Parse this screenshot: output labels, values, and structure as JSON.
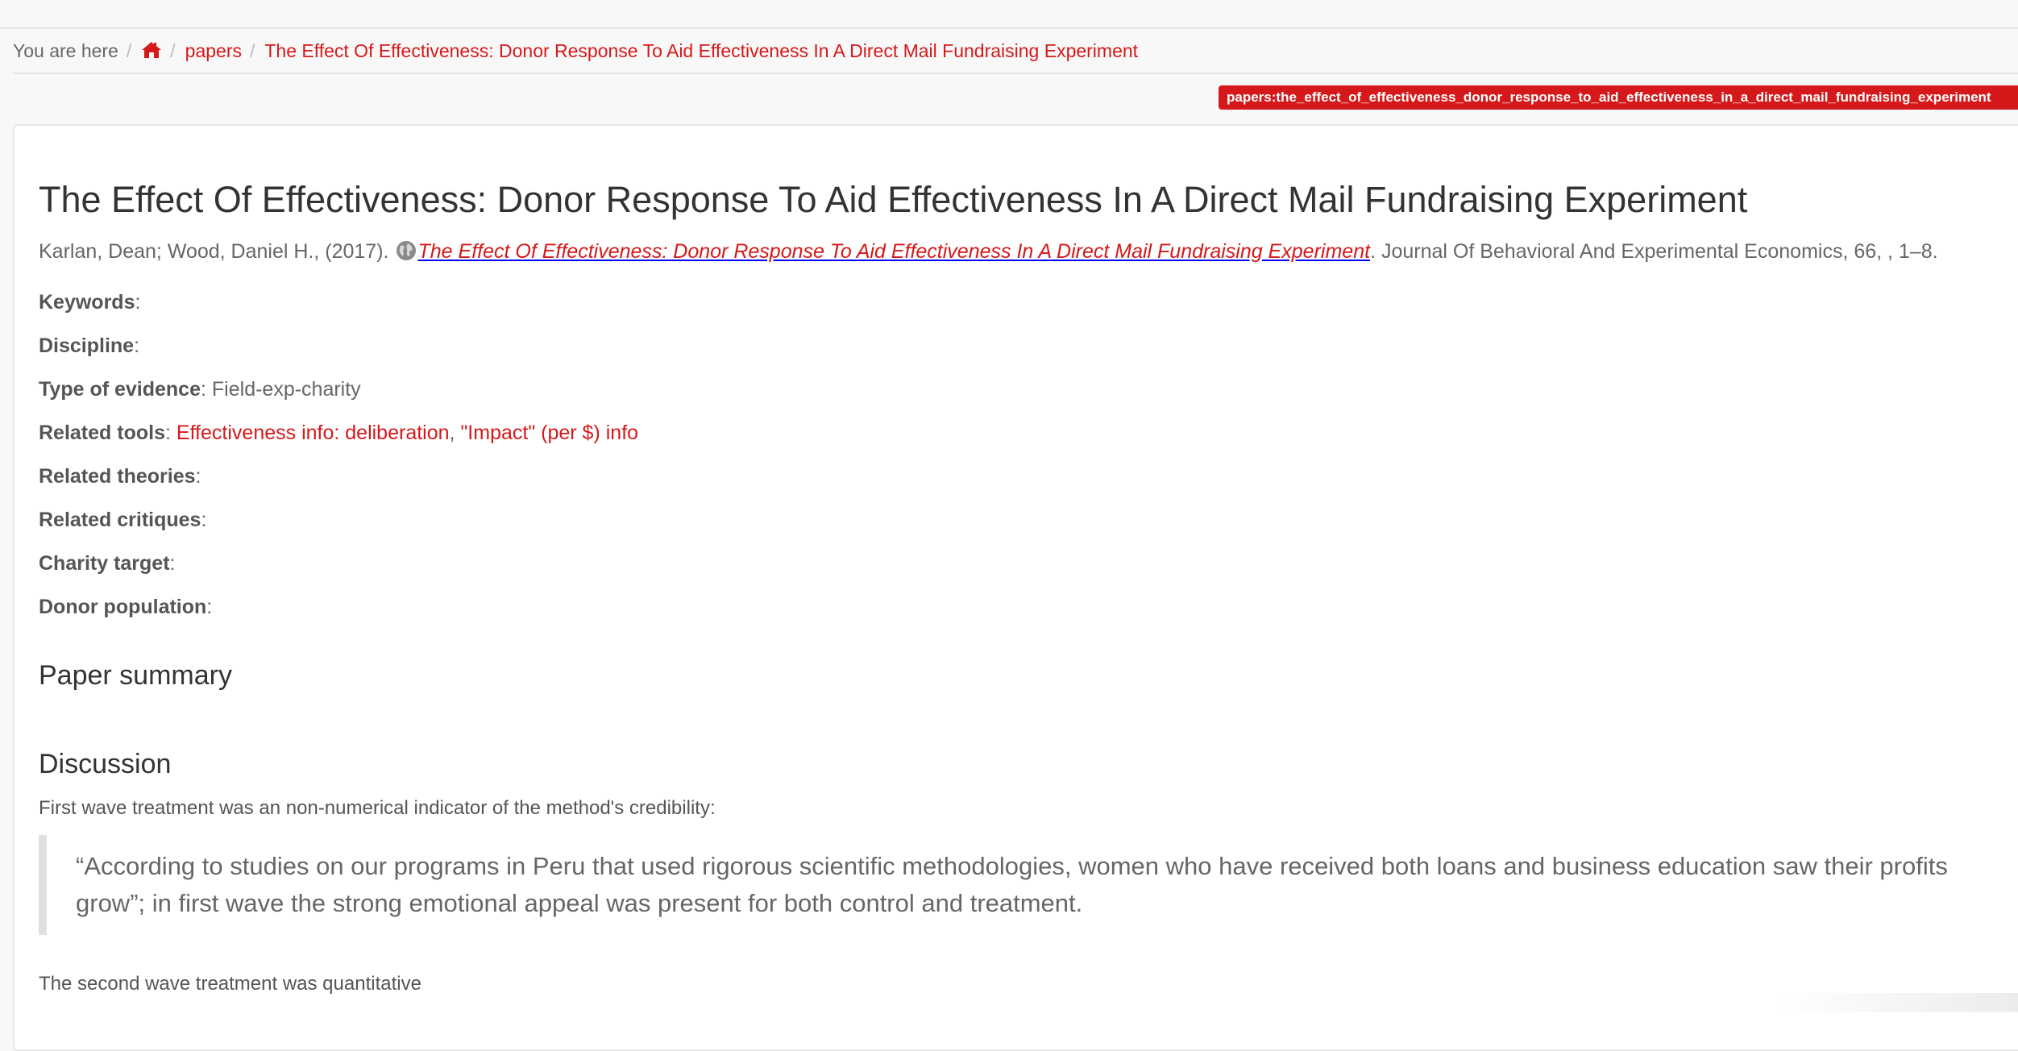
{
  "breadcrumb": {
    "label": "You are here",
    "home_icon": "home-icon",
    "section": "papers",
    "current": "The Effect Of Effectiveness: Donor Response To Aid Effectiveness In A Direct Mail Fundraising Experiment"
  },
  "page_id": "papers:the_effect_of_effectiveness_donor_response_to_aid_effectiveness_in_a_direct_mail_fundraising_experiment",
  "paper": {
    "title": "The Effect Of Effectiveness: Donor Response To Aid Effectiveness In A Direct Mail Fundraising Experiment",
    "citation_authors": "Karlan, Dean; Wood, Daniel H., (2017).",
    "citation_link_icon": "globe-icon",
    "citation_title": "The Effect Of Effectiveness: Donor Response To Aid Effectiveness In A Direct Mail Fundraising Experiment",
    "citation_journal": ". Journal Of Behavioral And Experimental Economics, 66, , 1–8."
  },
  "fields": {
    "keywords": {
      "label": "Keywords",
      "value": ""
    },
    "discipline": {
      "label": "Discipline",
      "value": ""
    },
    "evidence": {
      "label": "Type of evidence",
      "value": "Field-exp-charity"
    },
    "tools": {
      "label": "Related tools",
      "link1": "Effectiveness info: deliberation",
      "sep": ", ",
      "link2": "\"Impact\" (per $) info"
    },
    "theories": {
      "label": "Related theories",
      "value": ""
    },
    "critiques": {
      "label": "Related critiques",
      "value": ""
    },
    "charity_target": {
      "label": "Charity target",
      "value": ""
    },
    "donor_population": {
      "label": "Donor population",
      "value": ""
    }
  },
  "sections": {
    "summary_heading": "Paper summary",
    "discussion_heading": "Discussion",
    "discussion_intro": "First wave treatment was an non-numerical indicator of the method's credibility:",
    "quote": "“According to studies on our programs in Peru that used rigorous scientific methodologies, women who have received both loans and business education saw their profits grow”; in first wave the strong emotional appeal was present for both control and treatment.",
    "second_wave": "The second wave treatment was quantitative"
  },
  "colors": {
    "accent": "#d5191a",
    "text": "#4a4a4a",
    "background": "#f8f8f8"
  }
}
